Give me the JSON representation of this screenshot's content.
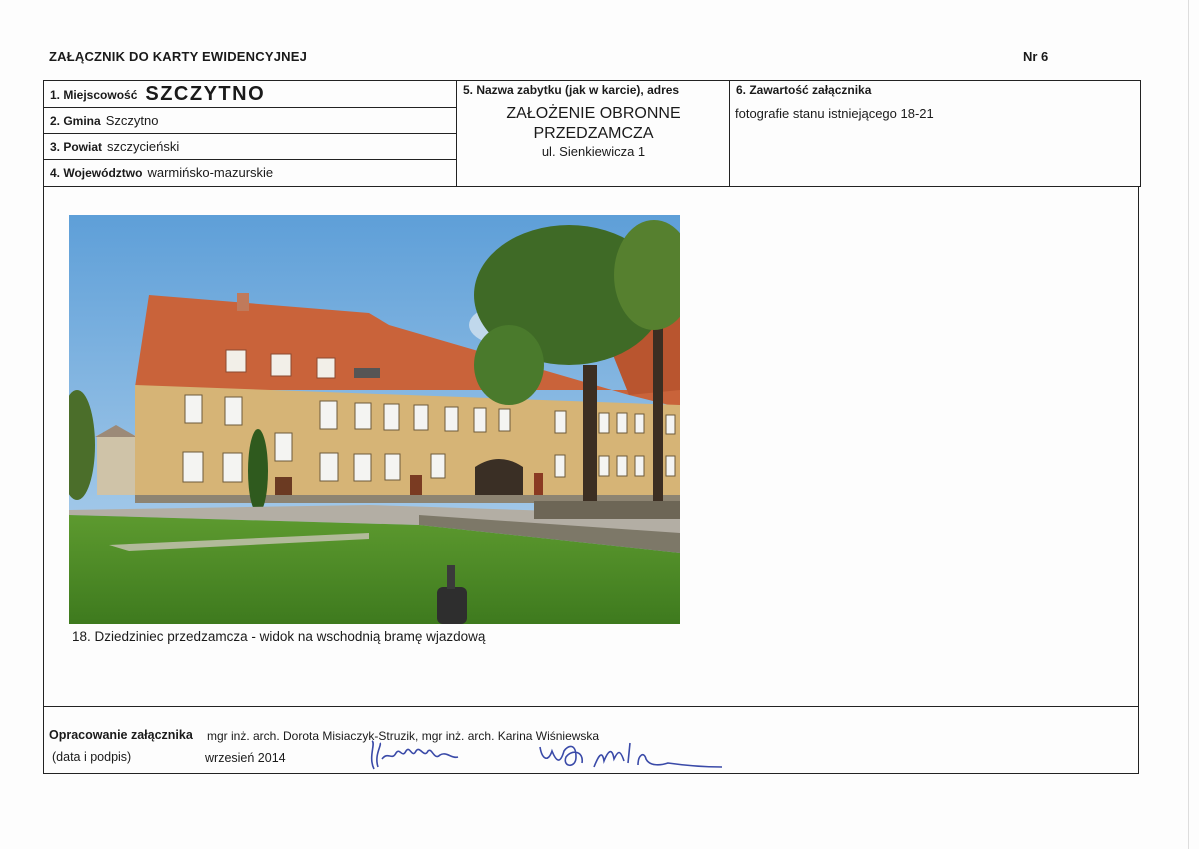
{
  "header": {
    "title": "ZAŁĄCZNIK DO KARTY EWIDENCYJNEJ",
    "number": "Nr 6"
  },
  "fields": {
    "miejscowosc": {
      "label": "1. Miejscowość",
      "value": "SZCZYTNO"
    },
    "gmina": {
      "label": "2. Gmina",
      "value": "Szczytno"
    },
    "powiat": {
      "label": "3. Powiat",
      "value": "szczycieński"
    },
    "wojewodztwo": {
      "label": "4. Województwo",
      "value": "warmińsko-mazurskie"
    },
    "nazwa": {
      "label": "5. Nazwa zabytku (jak w karcie), adres",
      "name_line1": "ZAŁOŻENIE OBRONNE",
      "name_line2": "PRZEDZAMCZA",
      "address": "ul. Sienkiewicza 1"
    },
    "zawartosc": {
      "label": "6. Zawartość załącznika",
      "value": "fotografie stanu istniejącego 18-21"
    }
  },
  "photo": {
    "caption": "18. Dziedziniec przedzamcza - widok na wschodnią bramę wjazdową"
  },
  "footer": {
    "prepared_label": "Opracowanie załącznika",
    "prepared_value": "mgr inż. arch. Dorota Misiaczyk-Struzik, mgr inż. arch. Karina Wiśniewska",
    "date_label": "(data i podpis)",
    "date_value": "wrzesień 2014"
  },
  "colors": {
    "ink": "#1a1a1a",
    "border": "#222222",
    "signature": "#3a4aa8",
    "roof": "#c9633a",
    "wall": "#d6b476",
    "grass": "#4f8f2a",
    "sky": "#7fb3e0"
  }
}
